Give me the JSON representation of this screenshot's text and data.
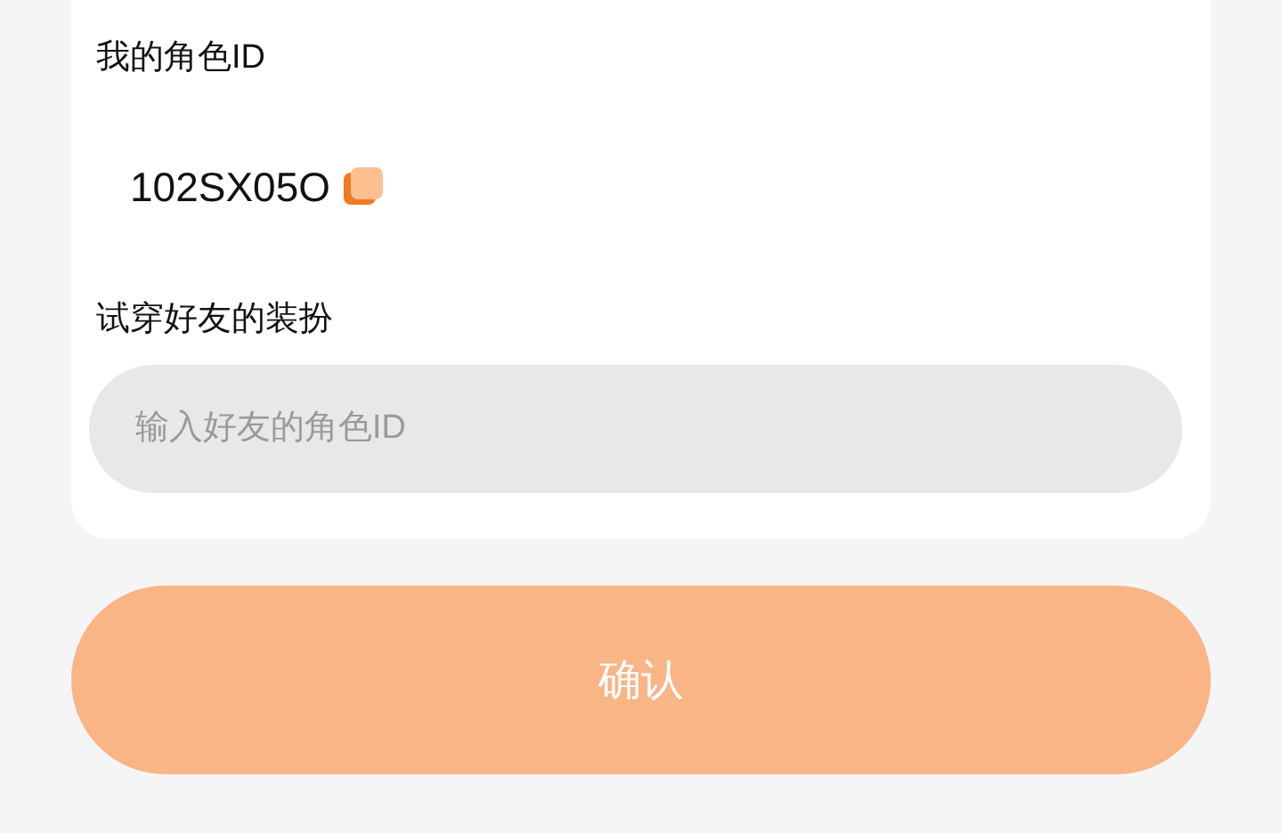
{
  "my_id": {
    "label": "我的角色ID",
    "value": "102SX05O"
  },
  "friend": {
    "label": "试穿好友的装扮",
    "placeholder": "输入好友的角色ID"
  },
  "confirm_button": "确认"
}
